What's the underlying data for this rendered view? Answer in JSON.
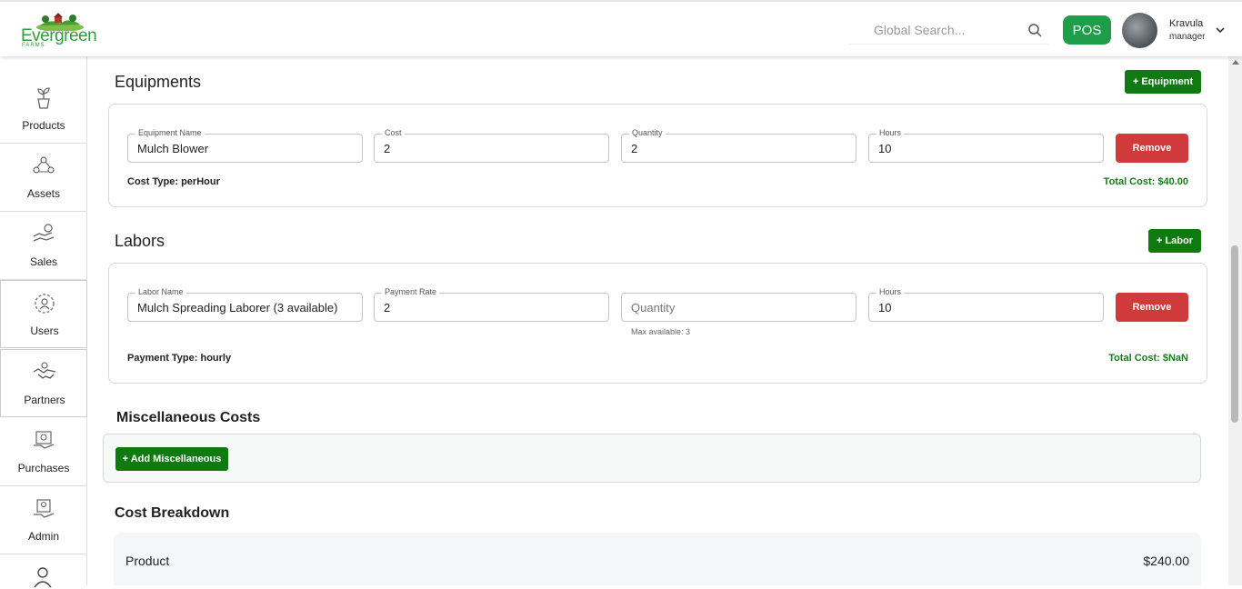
{
  "header": {
    "logo_text": "Evergreen",
    "logo_sub": "FARMS",
    "search_placeholder": "Global Search...",
    "pos_label": "POS",
    "user_name": "Kravula",
    "user_role": "manager"
  },
  "sidebar": {
    "items": [
      {
        "label": "Products",
        "icon": "plant-pot-icon"
      },
      {
        "label": "Assets",
        "icon": "assets-icon"
      },
      {
        "label": "Sales",
        "icon": "sales-icon"
      },
      {
        "label": "Users",
        "icon": "users-gear-icon"
      },
      {
        "label": "Partners",
        "icon": "handshake-icon"
      },
      {
        "label": "Purchases",
        "icon": "purchases-icon"
      },
      {
        "label": "Admin",
        "icon": "admin-icon"
      }
    ]
  },
  "equipments": {
    "title": "Equipments",
    "add_label": "+ Equipment",
    "item": {
      "name_label": "Equipment Name",
      "name_value": "Mulch Blower",
      "cost_label": "Cost",
      "cost_value": "2",
      "quantity_label": "Quantity",
      "quantity_value": "2",
      "hours_label": "Hours",
      "hours_value": "10",
      "remove_label": "Remove",
      "cost_type": "Cost Type: perHour",
      "total": "Total Cost: $40.00"
    }
  },
  "labors": {
    "title": "Labors",
    "add_label": "+ Labor",
    "item": {
      "name_label": "Labor Name",
      "name_value": "Mulch Spreading Laborer (3 available)",
      "rate_label": "Payment Rate",
      "rate_value": "2",
      "quantity_placeholder": "Quantity",
      "quantity_hint": "Max available: 3",
      "hours_label": "Hours",
      "hours_value": "10",
      "remove_label": "Remove",
      "payment_type": "Payment Type: hourly",
      "total": "Total Cost: $NaN"
    }
  },
  "misc": {
    "title": "Miscellaneous Costs",
    "add_label": "+ Add Miscellaneous"
  },
  "breakdown": {
    "title": "Cost Breakdown",
    "rows": [
      {
        "label": "Product",
        "value": "$240.00"
      }
    ]
  },
  "colors": {
    "brand_green": "#0f7a12",
    "pos_green": "#1e9e4a",
    "remove_red": "#d03a3a",
    "total_green": "#1b7a1b"
  }
}
